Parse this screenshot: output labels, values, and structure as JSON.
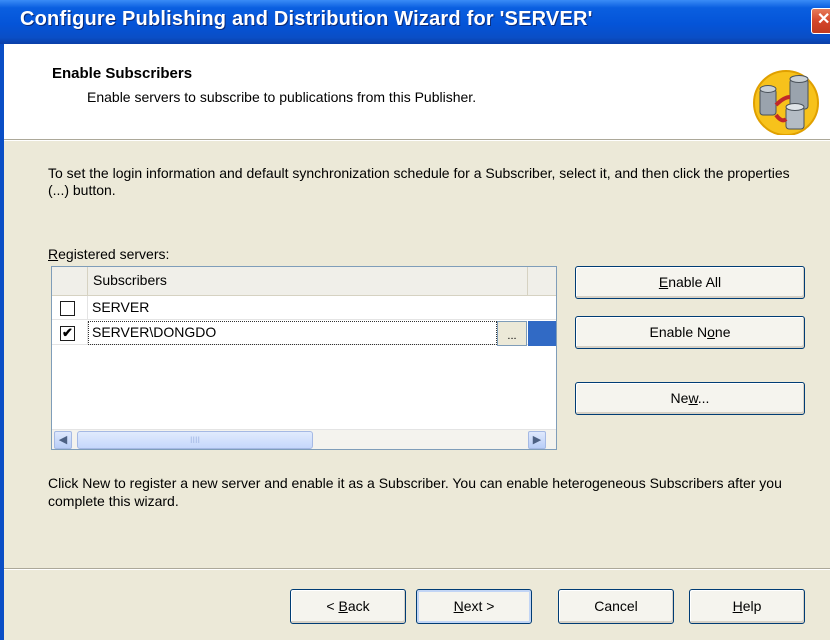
{
  "window": {
    "title": "Configure Publishing and Distribution Wizard for 'SERVER'",
    "close_glyph": "✕"
  },
  "header": {
    "title": "Enable Subscribers",
    "subtitle": "Enable servers to subscribe to publications from this Publisher.",
    "icon": "database-servers-icon"
  },
  "instructions": "To set the login information and default synchronization schedule for a Subscriber, select it, and then click the properties (...) button.",
  "servers": {
    "label_prefix": "",
    "label_mnemonic": "R",
    "label_rest": "egistered servers:",
    "column_header": "Subscribers",
    "rows": [
      {
        "name": "SERVER",
        "checked": false,
        "check_glyph": ""
      },
      {
        "name": "SERVER\\DONGDO",
        "checked": true,
        "check_glyph": "✔",
        "properties_label": "..."
      }
    ],
    "scroll_left": "◀",
    "scroll_right": "▶",
    "thumb_grip": "IIII"
  },
  "side_buttons": {
    "enable_all": {
      "mnemonic": "E",
      "rest": "nable All"
    },
    "enable_none": {
      "prefix": "Enable N",
      "mnemonic": "o",
      "rest": "ne"
    },
    "new": {
      "prefix": "Ne",
      "mnemonic": "w",
      "rest": "..."
    }
  },
  "note": "Click New to register a new server and enable it as a Subscriber. You can enable heterogeneous Subscribers after you complete this wizard.",
  "footer": {
    "back": {
      "prefix": "< ",
      "mnemonic": "B",
      "rest": "ack"
    },
    "next": {
      "mnemonic": "N",
      "rest": "ext >"
    },
    "cancel": "Cancel",
    "help": {
      "mnemonic": "H",
      "rest": "elp"
    }
  }
}
